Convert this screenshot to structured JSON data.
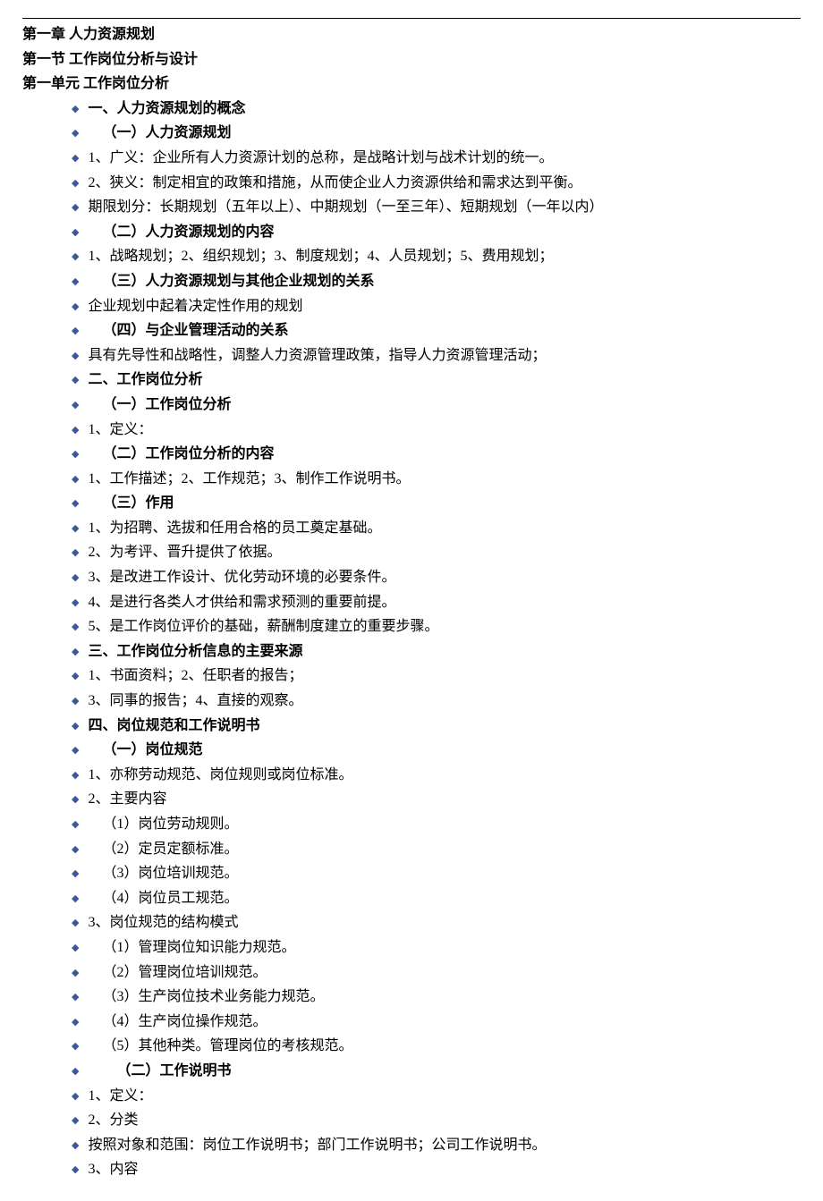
{
  "headings": {
    "chapter": "第一章 人力资源规划",
    "section": "第一节 工作岗位分析与设计",
    "unit": "第一单元 工作岗位分析"
  },
  "items": [
    {
      "text": "一、人力资源规划的概念",
      "bold": true
    },
    {
      "text": "（一）人力资源规划",
      "bold": true,
      "indent": true
    },
    {
      "text": "1、广义：企业所有人力资源计划的总称，是战略计划与战术计划的统一。"
    },
    {
      "text": "2、狭义：制定相宜的政策和措施，从而使企业人力资源供给和需求达到平衡。"
    },
    {
      "text": "期限划分：长期规划（五年以上）、中期规划（一至三年）、短期规划（一年以内）"
    },
    {
      "text": "（二）人力资源规划的内容",
      "bold": true,
      "indent": true
    },
    {
      "text": "1、战略规划；2、组织规划；3、制度规划；4、人员规划；5、费用规划；"
    },
    {
      "text": "（三）人力资源规划与其他企业规划的关系",
      "bold": true,
      "indent": true
    },
    {
      "text": "企业规划中起着决定性作用的规划"
    },
    {
      "text": "（四）与企业管理活动的关系",
      "bold": true,
      "indent": true
    },
    {
      "text": "具有先导性和战略性，调整人力资源管理政策，指导人力资源管理活动；"
    },
    {
      "text": "二、工作岗位分析",
      "bold": true
    },
    {
      "text": "（一）工作岗位分析",
      "bold": true,
      "indent": true
    },
    {
      "text": "1、定义："
    },
    {
      "text": "（二）工作岗位分析的内容",
      "bold": true,
      "indent": true
    },
    {
      "text": "1、工作描述；2、工作规范；3、制作工作说明书。"
    },
    {
      "text": "（三）作用",
      "bold": true,
      "indent": true
    },
    {
      "text": "1、为招聘、选拔和任用合格的员工奠定基础。"
    },
    {
      "text": "2、为考评、晋升提供了依据。"
    },
    {
      "text": "3、是改进工作设计、优化劳动环境的必要条件。"
    },
    {
      "text": "4、是进行各类人才供给和需求预测的重要前提。"
    },
    {
      "text": "5、是工作岗位评价的基础，薪酬制度建立的重要步骤。"
    },
    {
      "text": "三、工作岗位分析信息的主要来源",
      "bold": true
    },
    {
      "text": "1、书面资料；2、任职者的报告；"
    },
    {
      "text": "3、同事的报告；4、直接的观察。"
    },
    {
      "text": "四、岗位规范和工作说明书",
      "bold": true
    },
    {
      "text": "（一）岗位规范",
      "bold": true,
      "indent": true
    },
    {
      "text": "1、亦称劳动规范、岗位规则或岗位标准。"
    },
    {
      "text": "2、主要内容"
    },
    {
      "text": "（1）岗位劳动规则。",
      "indent": true
    },
    {
      "text": "（2）定员定额标准。",
      "indent": true
    },
    {
      "text": "（3）岗位培训规范。",
      "indent": true
    },
    {
      "text": "（4）岗位员工规范。",
      "indent": true
    },
    {
      "text": "3、岗位规范的结构模式"
    },
    {
      "text": "（1）管理岗位知识能力规范。",
      "indent": true
    },
    {
      "text": "（2）管理岗位培训规范。",
      "indent": true
    },
    {
      "text": "（3）生产岗位技术业务能力规范。",
      "indent": true
    },
    {
      "text": "（4）生产岗位操作规范。",
      "indent": true
    },
    {
      "text": "（5）其他种类。管理岗位的考核规范。",
      "indent": true
    },
    {
      "text": "（二）工作说明书",
      "bold": true,
      "indent2": true
    },
    {
      "text": "1、定义："
    },
    {
      "text": "2、分类"
    },
    {
      "text": "按照对象和范围：岗位工作说明书；部门工作说明书；公司工作说明书。"
    },
    {
      "text": "3、内容"
    }
  ]
}
